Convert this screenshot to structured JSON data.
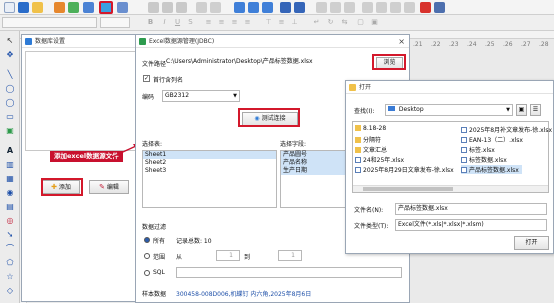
{
  "ruler": {
    "ticks": [
      ".21",
      ".22",
      ".23",
      ".24",
      ".25",
      ".26",
      ".27",
      ".28"
    ]
  },
  "data_source_manager": {
    "title": "数据库设置",
    "add_label": "添加",
    "edit_label": "编辑"
  },
  "annotation": {
    "text": "添加excel数据源文件"
  },
  "excel_dialog": {
    "title": "Excel数据源管理(JDBC)",
    "file_path_label": "文件路径",
    "file_path_value": "C:\\Users\\Administrator\\Desktop\\产品标签数据.xlsx",
    "browse_label": "浏览",
    "header_row_label": "首行含列名",
    "encoding_label": "编码",
    "encoding_value": "GB2312",
    "test_connection_label": "测试连接",
    "select_table_label": "选择表:",
    "tables": [
      "Sheet1",
      "Sheet2",
      "Sheet3"
    ],
    "select_field_label": "选择字段:",
    "fields": [
      "产品圆号",
      "产品名称",
      "生产日期"
    ],
    "data_filter_label": "数据过滤",
    "all_label": "所有",
    "record_total_label": "记录总数: 10",
    "range_label": "范围",
    "from_label": "从",
    "to_label": "到",
    "from_value": "1",
    "to_value": "1",
    "sql_label": "SQL",
    "sample_data_label": "样本数据",
    "sample_data_value": "300458-008D006,机蝶钉 内六角,2025年8月6日"
  },
  "open_dialog": {
    "title": "打开",
    "look_in_label": "查找(I):",
    "look_in_value": "Desktop",
    "files": [
      {
        "name": "8.18-28",
        "type": "folder"
      },
      {
        "name": "分隔符",
        "type": "folder"
      },
      {
        "name": "文章汇总",
        "type": "folder"
      },
      {
        "name": "24和25年.xlsx",
        "type": "file"
      },
      {
        "name": "2025年8月29日文章发布-徐.xlsx",
        "type": "file"
      },
      {
        "name": "2025年8月补文章发布-徐.xlsx",
        "type": "file"
      },
      {
        "name": "EAN-13（二）.xlsx",
        "type": "file"
      },
      {
        "name": "标签.xlsx",
        "type": "file"
      },
      {
        "name": "标签数据.xlsx",
        "type": "file"
      },
      {
        "name": "产品标签数据.xlsx",
        "type": "file"
      }
    ],
    "file_name_label": "文件名(N):",
    "file_name_value": "产品标签数据.xlsx",
    "file_type_label": "文件类型(T):",
    "file_type_value": "Excel文件(*.xls|*.xlsx|*.xlsm)",
    "open_label": "打开"
  }
}
